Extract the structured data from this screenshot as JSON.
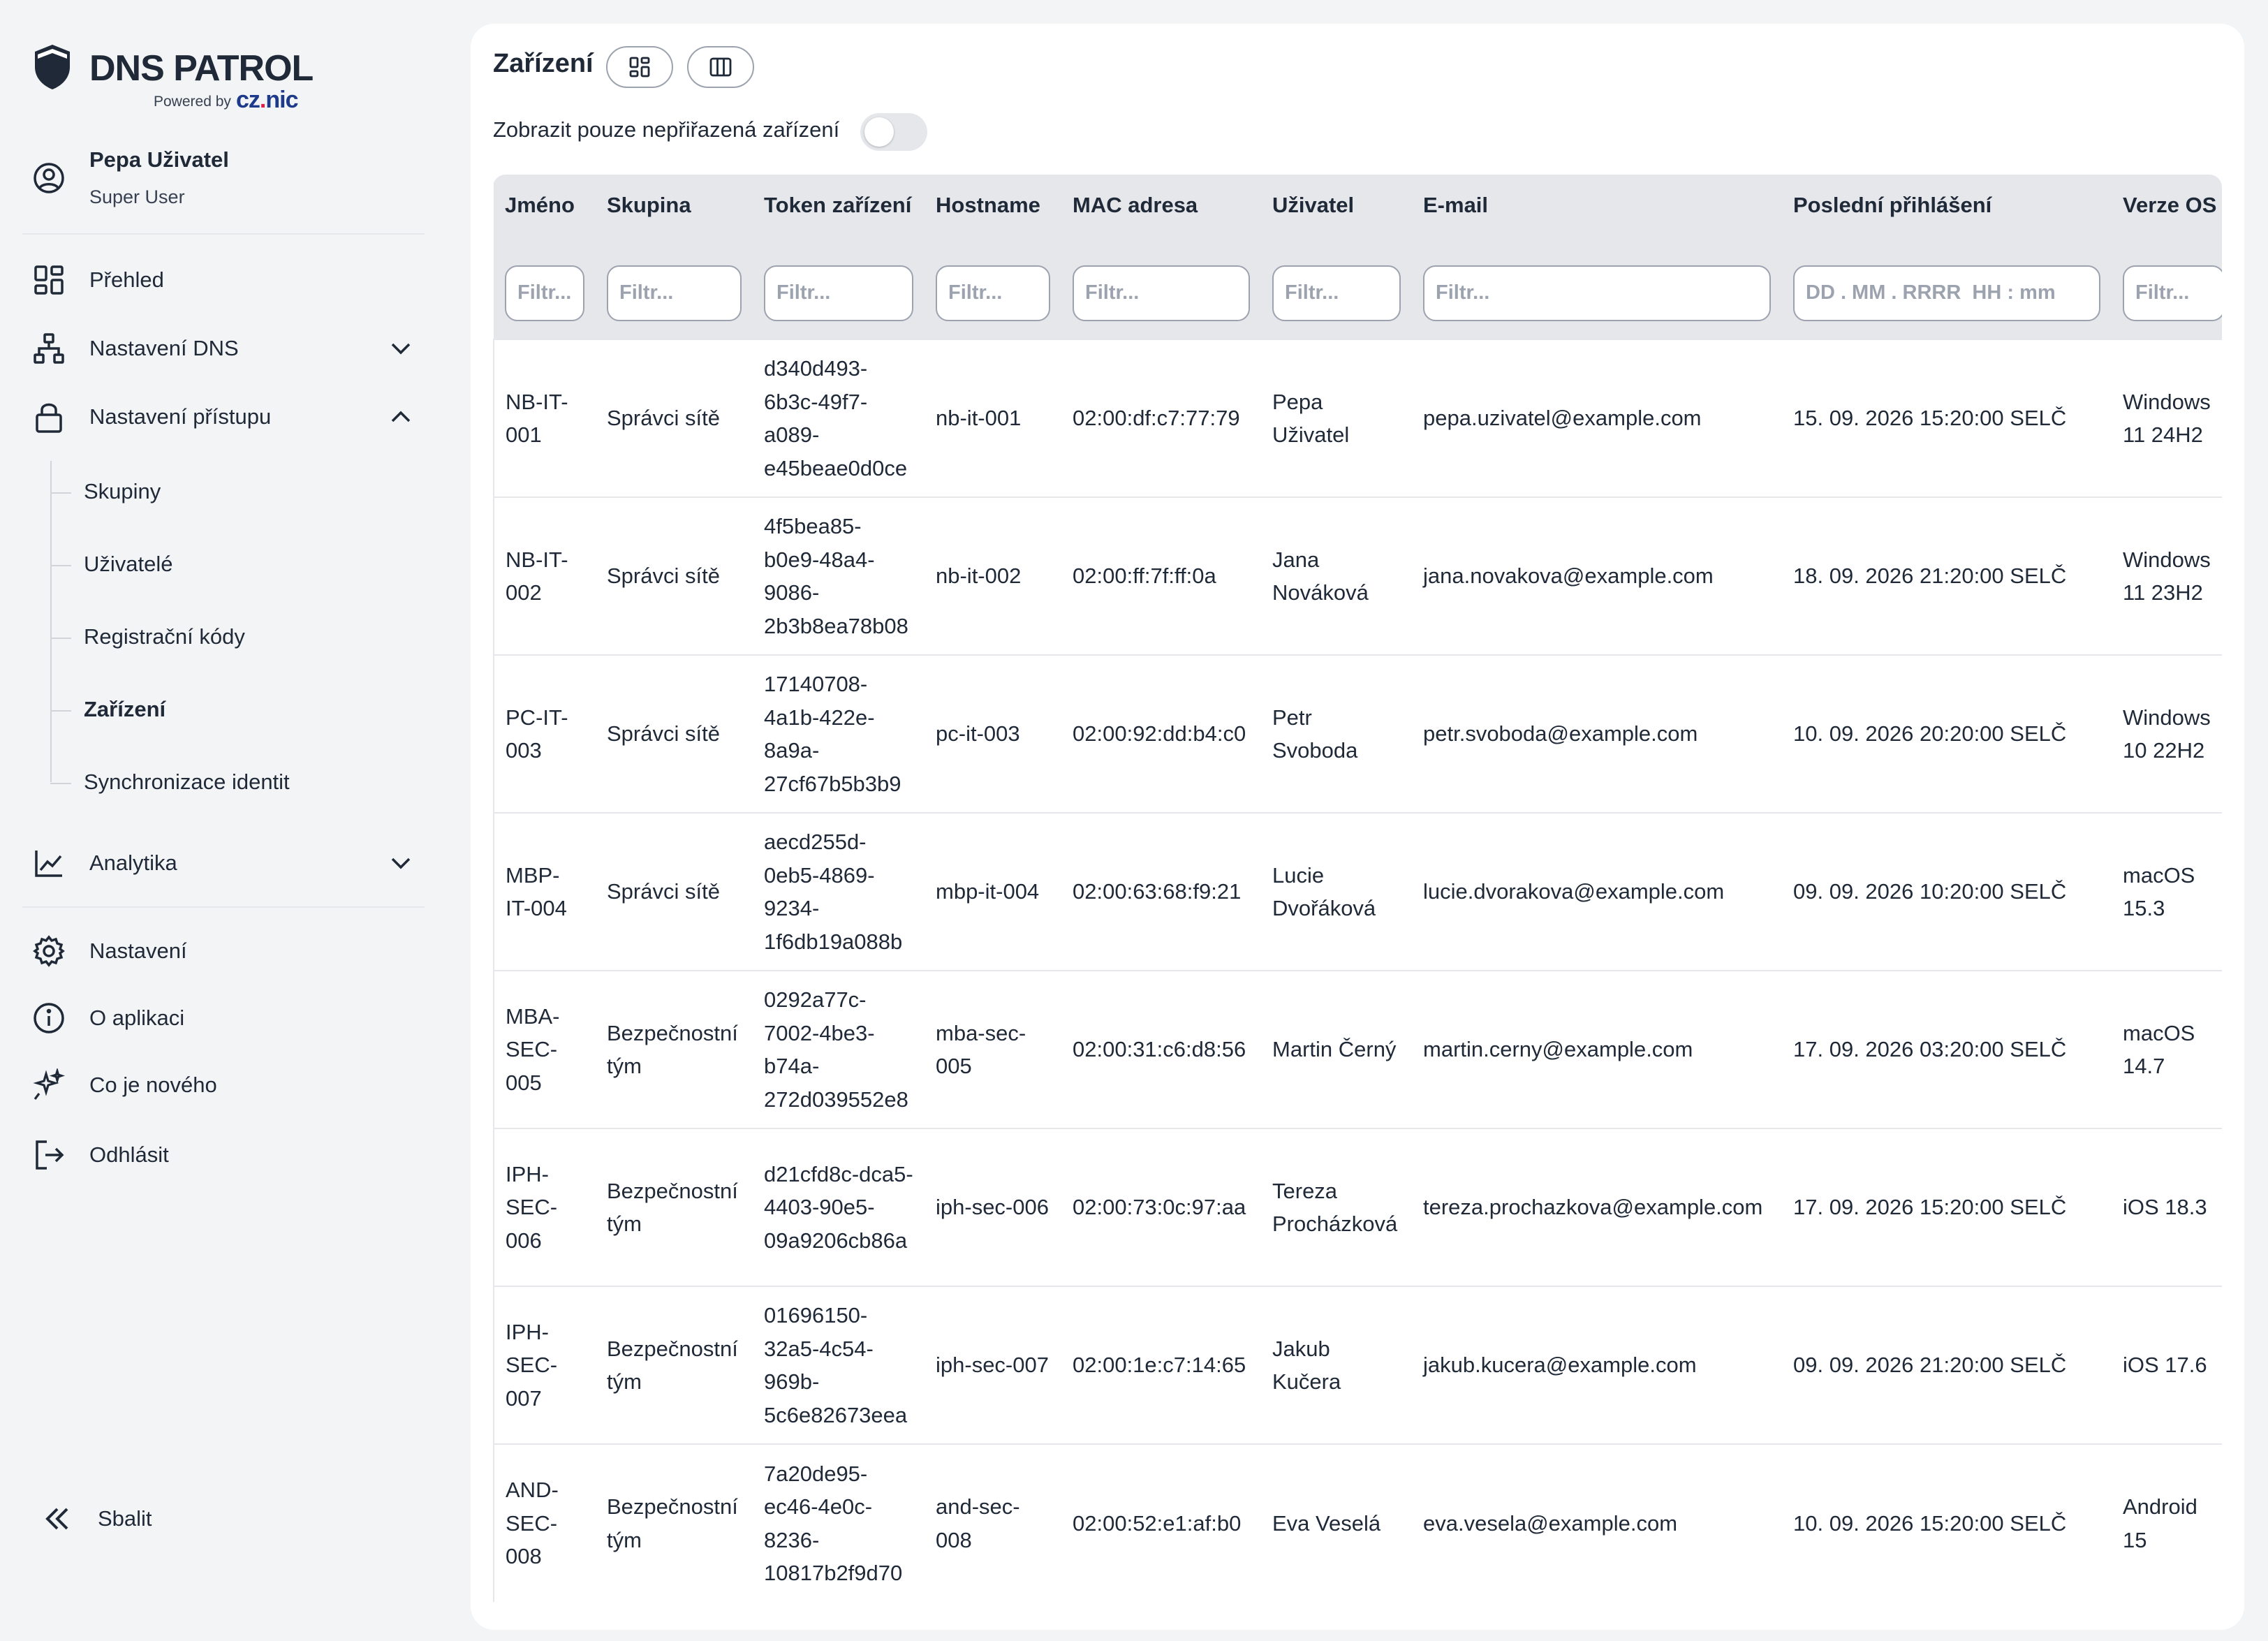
{
  "brand": {
    "name": "DNS PATROL",
    "powered_by": "Powered by",
    "partner_a": "cz",
    "partner_dot": ".",
    "partner_b": "nic"
  },
  "user": {
    "name": "Pepa Uživatel",
    "role": "Super User"
  },
  "nav": {
    "overview": "Přehled",
    "dns_settings": "Nastavení DNS",
    "access_settings": "Nastavení přístupu",
    "sub_items": [
      "Skupiny",
      "Uživatelé",
      "Registrační kódy",
      "Zařízení",
      "Synchronizace identit"
    ],
    "analytics": "Analytika",
    "settings": "Nastavení",
    "about": "O aplikaci",
    "whats_new": "Co je nového",
    "logout": "Odhlásit",
    "collapse": "Sbalit"
  },
  "page": {
    "title": "Zařízení",
    "toggle_label": "Zobrazit pouze nepřiřazená zařízení",
    "toggle_on": false
  },
  "table": {
    "columns": [
      "Jméno",
      "Skupina",
      "Token zařízení",
      "Hostname",
      "MAC adresa",
      "Uživatel",
      "E-mail",
      "Poslední přihlášení",
      "Verze OS"
    ],
    "filter_placeholder": "Filtr...",
    "date_placeholder": "DD . MM . RRRR  HH : mm",
    "rows": [
      [
        "NB-IT-001",
        "Správci sítě",
        "d340d493-6b3c-49f7-a089-e45beae0d0ce",
        "nb-it-001",
        "02:00:df:c7:77:79",
        "Pepa Uživatel",
        "pepa.uzivatel@example.com",
        "15. 09. 2026 15:20:00 SELČ",
        "Windows 11 24H2"
      ],
      [
        "NB-IT-002",
        "Správci sítě",
        "4f5bea85-b0e9-48a4-9086-2b3b8ea78b08",
        "nb-it-002",
        "02:00:ff:7f:ff:0a",
        "Jana Nováková",
        "jana.novakova@example.com",
        "18. 09. 2026 21:20:00 SELČ",
        "Windows 11 23H2"
      ],
      [
        "PC-IT-003",
        "Správci sítě",
        "17140708-4a1b-422e-8a9a-27cf67b5b3b9",
        "pc-it-003",
        "02:00:92:dd:b4:c0",
        "Petr Svoboda",
        "petr.svoboda@example.com",
        "10. 09. 2026 20:20:00 SELČ",
        "Windows 10 22H2"
      ],
      [
        "MBP-IT-004",
        "Správci sítě",
        "aecd255d-0eb5-4869-9234-1f6db19a088b",
        "mbp-it-004",
        "02:00:63:68:f9:21",
        "Lucie Dvořáková",
        "lucie.dvorakova@example.com",
        "09. 09. 2026 10:20:00 SELČ",
        "macOS 15.3"
      ],
      [
        "MBA-SEC-005",
        "Bezpečnostní tým",
        "0292a77c-7002-4be3-b74a-272d039552e8",
        "mba-sec-005",
        "02:00:31:c6:d8:56",
        "Martin Černý",
        "martin.cerny@example.com",
        "17. 09. 2026 03:20:00 SELČ",
        "macOS 14.7"
      ],
      [
        "IPH-SEC-006",
        "Bezpečnostní tým",
        "d21cfd8c-dca5-4403-90e5-09a9206cb86a",
        "iph-sec-006",
        "02:00:73:0c:97:aa",
        "Tereza Procházková",
        "tereza.prochazkova@example.com",
        "17. 09. 2026 15:20:00 SELČ",
        "iOS 18.3"
      ],
      [
        "IPH-SEC-007",
        "Bezpečnostní tým",
        "01696150-32a5-4c54-969b-5c6e82673eea",
        "iph-sec-007",
        "02:00:1e:c7:14:65",
        "Jakub Kučera",
        "jakub.kucera@example.com",
        "09. 09. 2026 21:20:00 SELČ",
        "iOS 17.6"
      ],
      [
        "AND-SEC-008",
        "Bezpečnostní tým",
        "7a20de95-ec46-4e0c-8236-10817b2f9d70",
        "and-sec-008",
        "02:00:52:e1:af:b0",
        "Eva Veselá",
        "eva.vesela@example.com",
        "10. 09. 2026 15:20:00 SELČ",
        "Android 15"
      ]
    ]
  }
}
